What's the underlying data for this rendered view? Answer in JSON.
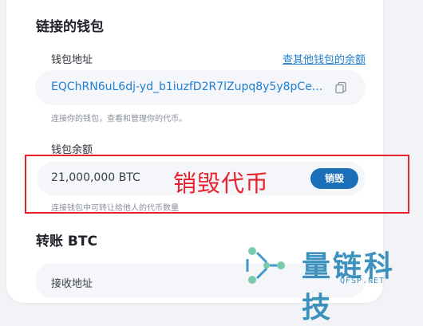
{
  "linked_wallet": {
    "title": "链接的钱包",
    "address_label": "钱包地址",
    "other_wallets_link": "查其他钱包的余额",
    "address": "EQChRN6uL6dj-yd_b1iuzfD2R7lZupq8y5y8pCe...",
    "address_hint": "连接你的钱包，查看和管理你的代币。",
    "balance_label": "钱包余额",
    "balance": "21,000,000 BTC",
    "burn_button": "销毁",
    "balance_hint": "连接钱包中可转让给他人的代币数量"
  },
  "annotation": {
    "text": "销毁代币",
    "color": "#e8212d"
  },
  "transfer": {
    "title": "转账 BTC",
    "receive_address_label": "接收地址"
  },
  "watermark": {
    "name": "量链科技",
    "domain": "QFSP.NET"
  },
  "colors": {
    "accent": "#1f7fd0",
    "button": "#1b6fb8"
  }
}
